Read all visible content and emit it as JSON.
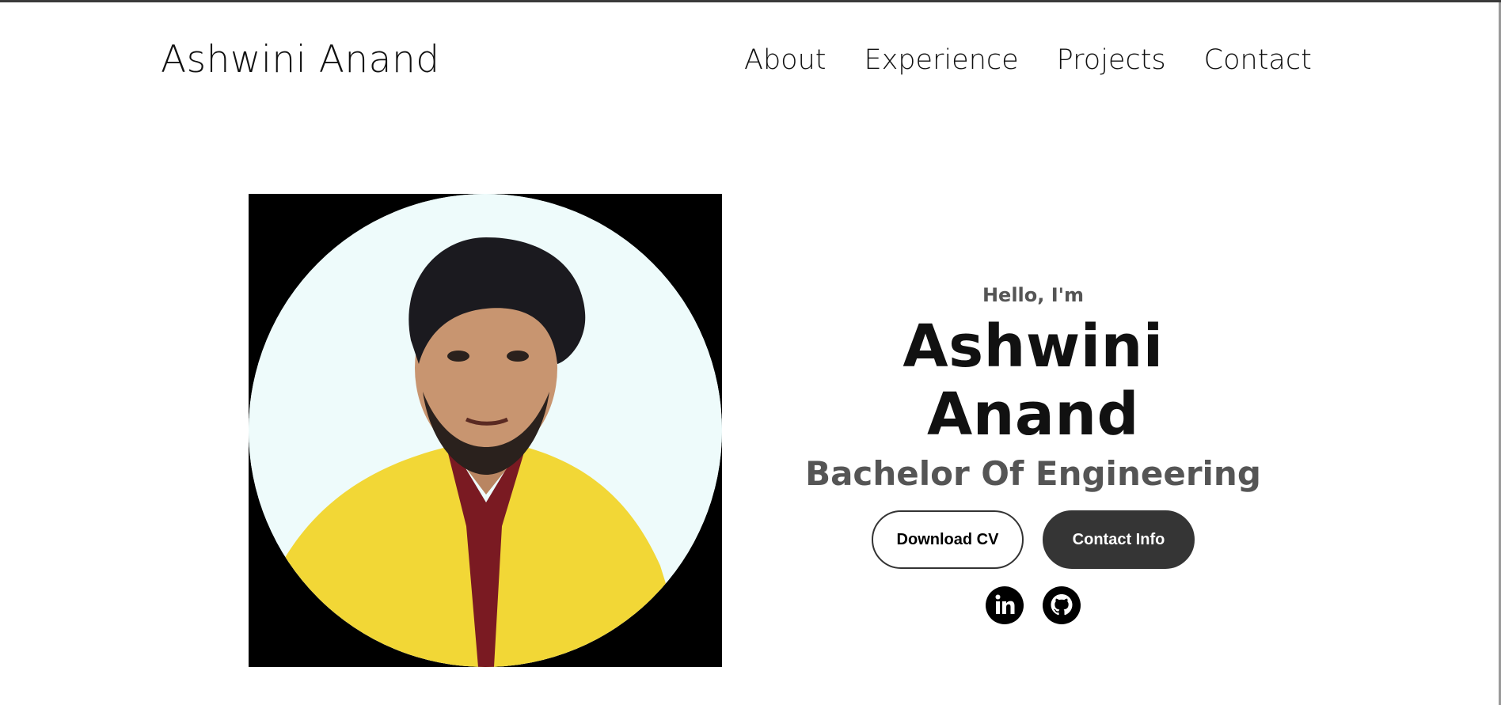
{
  "header": {
    "logo": "Ashwini Anand",
    "nav": [
      {
        "label": "About"
      },
      {
        "label": "Experience"
      },
      {
        "label": "Projects"
      },
      {
        "label": "Contact"
      }
    ]
  },
  "hero": {
    "greeting": "Hello, I'm",
    "name": "Ashwini Anand",
    "title": "Bachelor Of Engineering",
    "buttons": {
      "download_cv": "Download CV",
      "contact_info": "Contact Info"
    },
    "socials": [
      {
        "icon": "linkedin-icon"
      },
      {
        "icon": "github-icon"
      }
    ]
  },
  "colors": {
    "text_dark": "#111111",
    "text_muted": "#555555",
    "button_dark": "#353535",
    "photo_frame": "#000000",
    "photo_shirt": "#f2d736"
  }
}
